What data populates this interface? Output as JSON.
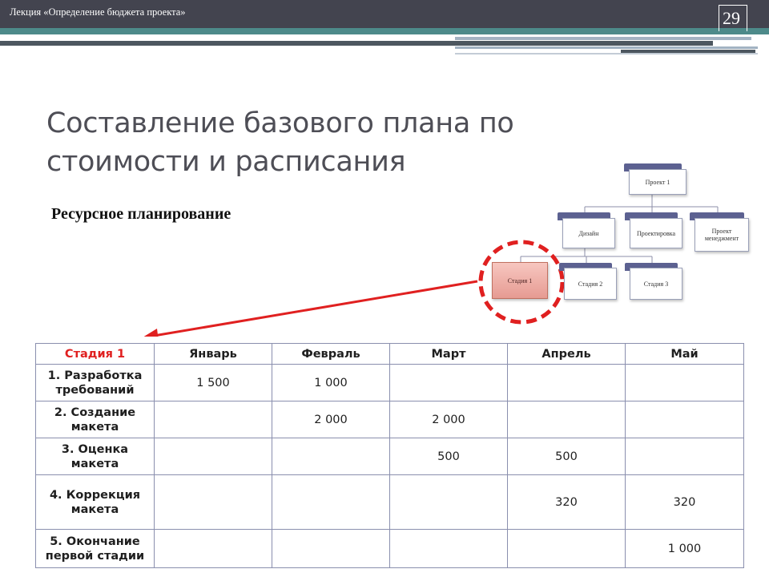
{
  "header": {
    "lecture_title": "Лекция «Определение бюджета проекта»",
    "slide_number": "29"
  },
  "slide": {
    "title": "Составление базового плана по стоимости и расписания",
    "subtitle": "Ресурсное планирование"
  },
  "org_chart": {
    "root": "Проект 1",
    "level2": [
      "Дизайн",
      "Проектировка",
      "Проект менеджмент"
    ],
    "level3": [
      "Стадия 1",
      "Стадия 2",
      "Стадия 3"
    ],
    "highlighted": "Стадия 1",
    "highlight_color": "#e02020"
  },
  "table": {
    "columns": [
      "Стадия 1",
      "Январь",
      "Февраль",
      "Март",
      "Апрель",
      "Май"
    ],
    "rows": [
      {
        "task": "1. Разработка требований",
        "values": [
          "1 500",
          "1 000",
          "",
          "",
          ""
        ]
      },
      {
        "task": "2. Создание макета",
        "values": [
          "",
          "2 000",
          "2 000",
          "",
          ""
        ]
      },
      {
        "task": "3. Оценка макета",
        "values": [
          "",
          "",
          "500",
          "500",
          ""
        ]
      },
      {
        "task": "4. Коррекция макета",
        "values": [
          "",
          "",
          "",
          "320",
          "320"
        ]
      },
      {
        "task": "5. Окончание первой стадии",
        "values": [
          "",
          "",
          "",
          "",
          "1 000"
        ]
      }
    ]
  }
}
